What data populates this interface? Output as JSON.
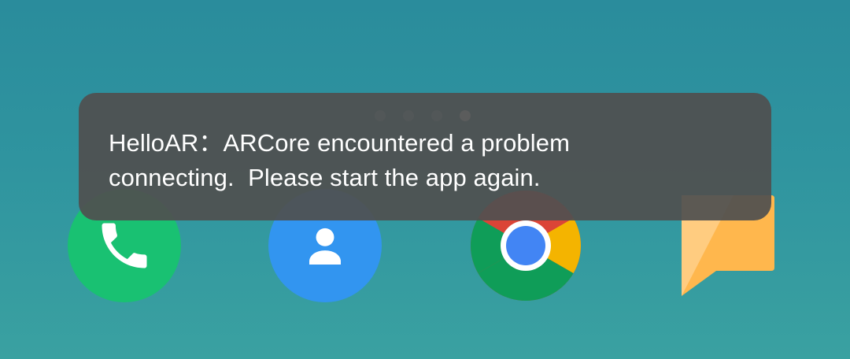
{
  "home_screen": {
    "page_indicator": {
      "count": 4,
      "active_index": 3
    },
    "dock": [
      {
        "app": "Phone",
        "icon": "phone-icon",
        "color": "#19c172"
      },
      {
        "app": "Contacts",
        "icon": "contacts-icon",
        "color": "#3295f0"
      },
      {
        "app": "Chrome",
        "icon": "chrome-icon",
        "color": "#4285f4"
      },
      {
        "app": "Messages",
        "icon": "message-icon",
        "color": "#ffb74d"
      }
    ]
  },
  "toast": {
    "line1": "HelloAR：ARCore encountered a problem",
    "line2": "connecting.  Please start the app again.",
    "background": "#505050"
  }
}
